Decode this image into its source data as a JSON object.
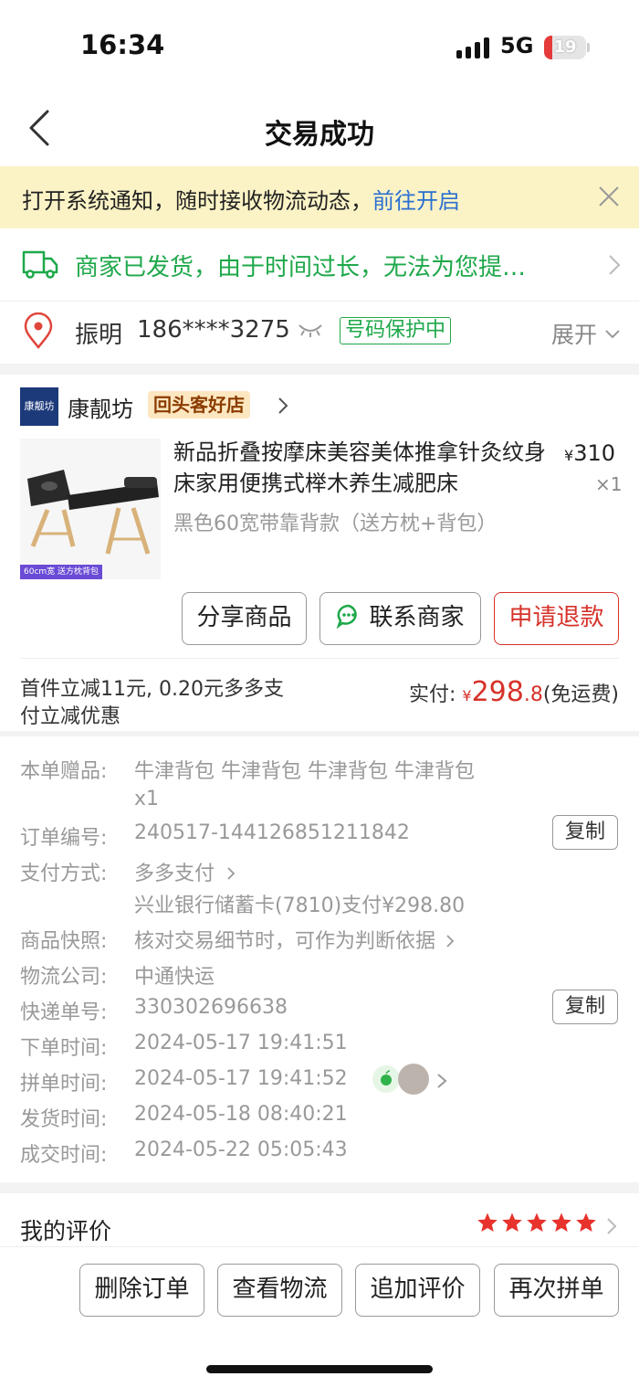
{
  "status_bar": {
    "time": "16:34",
    "network": "5G",
    "battery": "19",
    "battery_level": 0.19
  },
  "nav": {
    "title": "交易成功"
  },
  "notice": {
    "text": "打开系统通知，随时接收物流动态，",
    "link": "前往开启"
  },
  "shipping": {
    "text": "商家已发货，由于时间过长，无法为您提…"
  },
  "address": {
    "name": "振明",
    "phone": "186****3275",
    "badge": "号码保护中",
    "expand": "展开"
  },
  "shop": {
    "logo_text": "康靓坊",
    "name": "康靓坊",
    "badge": "回头客好店"
  },
  "product": {
    "title": "新品折叠按摩床美容美体推拿针灸纹身床家用便携式榉木养生减肥床",
    "spec": "黑色60宽带靠背款（送方枕+背包）",
    "currency": "¥",
    "price": "310",
    "qty": "×1",
    "image_caption": "60cm宽 送方枕背包"
  },
  "actions": {
    "share": "分享商品",
    "contact": "联系商家",
    "refund": "申请退款"
  },
  "payment": {
    "promo": "首件立减11元, 0.20元多多支付立减优惠",
    "paid_label": "实付: ",
    "currency": "¥",
    "amount_int": "298",
    "amount_dec": ".8",
    "shipping_note": "(免运费)"
  },
  "details": {
    "gift_label": "本单赠品:",
    "gift_value": "牛津背包 牛津背包 牛津背包 牛津背包",
    "gift_qty": "x1",
    "order_no_label": "订单编号:",
    "order_no": "240517-144126851211842",
    "pay_method_label": "支付方式:",
    "pay_method": "多多支付",
    "pay_detail": "兴业银行储蓄卡(7810)支付¥298.80",
    "snapshot_label": "商品快照:",
    "snapshot": "核对交易细节时，可作为判断依据",
    "courier_label": "物流公司:",
    "courier": "中通快运",
    "tracking_label": "快递单号:",
    "tracking": "330302696638",
    "order_time_label": "下单时间:",
    "order_time": "2024-05-17 19:41:51",
    "group_time_label": "拼单时间:",
    "group_time": "2024-05-17 19:41:52",
    "ship_time_label": "发货时间:",
    "ship_time": "2024-05-18 08:40:21",
    "deal_time_label": "成交时间:",
    "deal_time": "2024-05-22 05:05:43",
    "copy": "复制"
  },
  "review": {
    "label": "我的评价",
    "stars": 5
  },
  "bottom": {
    "delete": "删除订单",
    "logistics": "查看物流",
    "add_review": "追加评价",
    "rebuy": "再次拼单"
  },
  "colors": {
    "green": "#1ea84a",
    "red": "#d6322a",
    "link": "#2b6fd1",
    "notice_bg": "#fbf3c6"
  }
}
